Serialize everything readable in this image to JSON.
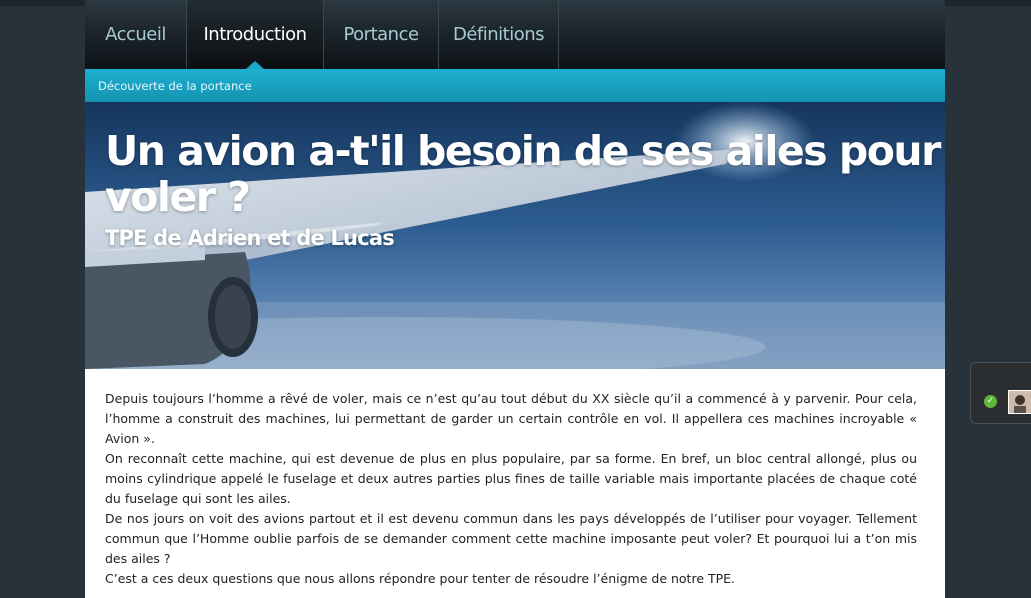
{
  "nav": {
    "items": [
      {
        "label": "Accueil"
      },
      {
        "label": "Introduction"
      },
      {
        "label": "Portance"
      },
      {
        "label": "Définitions"
      }
    ],
    "active_index": 1
  },
  "subnav": {
    "link": "Découverte de la portance"
  },
  "banner": {
    "title": "Un avion a-t'il besoin de ses ailes pour voler ?",
    "subtitle": "TPE de Adrien et de Lucas"
  },
  "content": {
    "paragraphs": [
      "Depuis toujours l’homme a rêvé de voler, mais ce n’est qu’au tout début du XX siècle qu’il a commencé à y parvenir. Pour cela, l’homme a construit des machines, lui permettant de garder un certain contrôle en vol. Il appellera ces machines incroyable « Avion ».",
      "On reconnaît cette machine, qui est devenue de plus en plus populaire, par sa forme. En bref, un bloc central allongé, plus ou moins cylindrique appelé le fuselage et deux autres parties plus fines de taille variable mais importante placées de chaque coté du fuselage qui sont les ailes.",
      "De nos jours on voit des avions partout et il est devenu commun dans les pays développés de l’utiliser pour voyager. Tellement commun que l’Homme oublie parfois de se demander comment cette machine imposante peut voler? Et pourquoi lui a t’on mis des ailes ?",
      "C’est a ces deux questions que nous allons répondre pour tenter de résoudre l’énigme de notre TPE."
    ]
  },
  "colors": {
    "accent": "#1cb0d1",
    "nav_text": "#a7c9d2",
    "background": "#27323b"
  },
  "widget": {
    "status_icon": "check-icon",
    "avatar": "user-avatar"
  }
}
